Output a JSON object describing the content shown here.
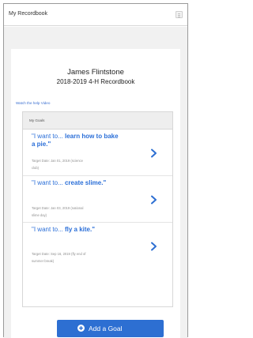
{
  "app": {
    "title": "My Recordbook"
  },
  "recordbook": {
    "member_name": "James Flintstone",
    "book_title": "2018-2019 4-H Recordbook"
  },
  "help_link": "Watch the help Video",
  "goals_section": {
    "header": "My Goals",
    "goals": [
      {
        "prefix": "\"I want to...",
        "goal": "learn how to bake a pie.\"",
        "meta_line1": "Target Date: Jan 01, 2019 (science",
        "meta_line2": "club)"
      },
      {
        "prefix": "\"I want to...",
        "goal": "create slime.\"",
        "meta_line1": "Target Date: Jan 03, 2019 (national",
        "meta_line2": "slime day)"
      },
      {
        "prefix": "\"I want to...",
        "goal": "fly a kite.\"",
        "meta_line1": "Target Date: Sep 16, 2019 (fly end of",
        "meta_line2": "summer break)"
      }
    ]
  },
  "add_goal_button": "Add a Goal",
  "colors": {
    "accent": "#2d6fd2",
    "link": "#2b6fd8",
    "background": "#f1f1f1"
  },
  "icons": {
    "menu": "hamburger-menu-icon",
    "goal_arrow": "chevron-right-icon",
    "add": "plus-circle-icon"
  }
}
